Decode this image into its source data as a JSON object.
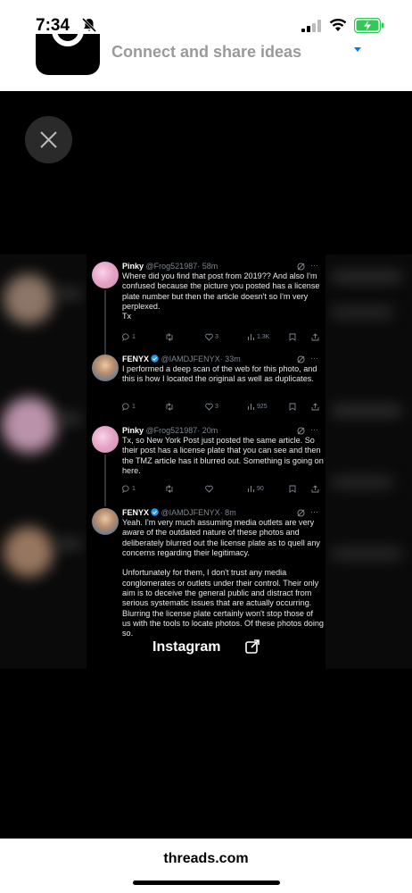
{
  "status": {
    "time": "7:34",
    "battery_color": "#34c759"
  },
  "banner": {
    "text": "Connect and share ideas",
    "accent": "#007aff"
  },
  "viewer": {
    "close_icon": "close-icon"
  },
  "tweets": [
    {
      "name": "Pinky",
      "handle": "@Frog521987",
      "time": "· 58m",
      "verified": false,
      "text": "Where did you find that post from 2019?? And also I'm confused because the picture you posted has a license plate number but then the article doesn't so I'm very perplexed.\nTx",
      "replies": "1",
      "retweets": "",
      "likes": "3",
      "views": "1.3K"
    },
    {
      "name": "FENYX",
      "handle": "@IAMDJFENYX",
      "time": "· 33m",
      "verified": true,
      "text": "I performed a deep scan of the web for this photo, and this is how I located the original as well as duplicates.",
      "replies": "1",
      "retweets": "",
      "likes": "3",
      "views": "925"
    },
    {
      "name": "Pinky",
      "handle": "@Frog521987",
      "time": "· 20m",
      "verified": false,
      "text": "Tx, so New York Post just posted the same article. So their post has a license plate that you can see and then the TMZ article has it blurred out. Something is going on here.",
      "replies": "1",
      "retweets": "",
      "likes": "",
      "views": "90"
    },
    {
      "name": "FENYX",
      "handle": "@IAMDJFENYX",
      "time": "· 8m",
      "verified": true,
      "text": "Yeah. I'm very much assuming media outlets are very aware of the outdated nature of these photos and deliberately blurred out the license plate as to quell any concerns regarding their legitimacy.\n\nUnfortunately for them, I don't trust any media conglomerates or outlets under their control. Their only aim is to deceive the general public and distract from serious systematic issues that are actually occurring. Blurring the license plate certainly won't stop those of us with the tools to locate photos. Of these photos doing so."
    }
  ],
  "overlay": {
    "label": "Instagram"
  },
  "footer": {
    "url": "threads.com"
  }
}
